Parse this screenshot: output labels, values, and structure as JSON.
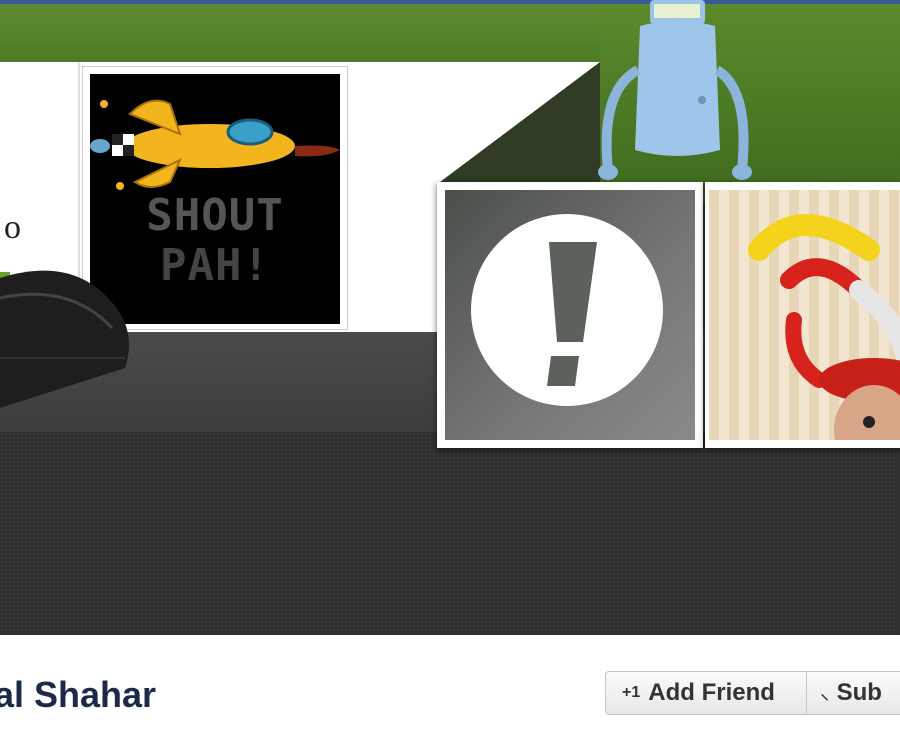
{
  "cover": {
    "edge_text": "o",
    "shout_line1": "SHOUT",
    "shout_line2": "PAH!"
  },
  "profile": {
    "name": "al Shahar",
    "add_friend_label": "Add Friend",
    "add_friend_icon": "+1",
    "subscribe_label": "Sub",
    "subscribe_icon": "rss-icon"
  },
  "colors": {
    "facebook_blue": "#3b5998",
    "name_color": "#1c2a47"
  }
}
